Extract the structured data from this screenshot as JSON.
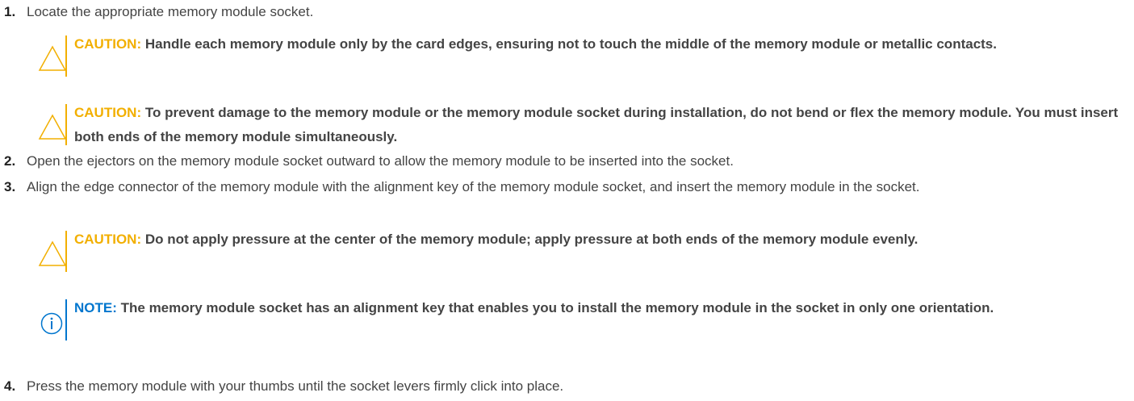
{
  "accent": {
    "caution": "#f2af00",
    "note": "#0076ce"
  },
  "steps": [
    {
      "num": "1.",
      "text": "Locate the appropriate memory module socket.",
      "notices": [
        {
          "type": "caution",
          "icon": "caution-triangle-icon",
          "label": "CAUTION:",
          "text": "Handle each memory module only by the card edges, ensuring not to touch the middle of the memory module or metallic contacts."
        },
        {
          "type": "caution",
          "icon": "caution-triangle-icon",
          "label": "CAUTION:",
          "text": "To prevent damage to the memory module or the memory module socket during installation, do not bend or flex the memory module. You must insert both ends of the memory module simultaneously."
        }
      ]
    },
    {
      "num": "2.",
      "text": "Open the ejectors on the memory module socket outward to allow the memory module to be inserted into the socket."
    },
    {
      "num": "3.",
      "text": "Align the edge connector of the memory module with the alignment key of the memory module socket, and insert the memory module in the socket.",
      "notices": [
        {
          "type": "caution",
          "icon": "caution-triangle-icon",
          "label": "CAUTION:",
          "text": "Do not apply pressure at the center of the memory module; apply pressure at both ends of the memory module evenly."
        },
        {
          "type": "note",
          "icon": "info-circle-icon",
          "label": "NOTE:",
          "text": "The memory module socket has an alignment key that enables you to install the memory module in the socket in only one orientation."
        }
      ]
    },
    {
      "num": "4.",
      "text": "Press the memory module with your thumbs until the socket levers firmly click into place."
    }
  ]
}
